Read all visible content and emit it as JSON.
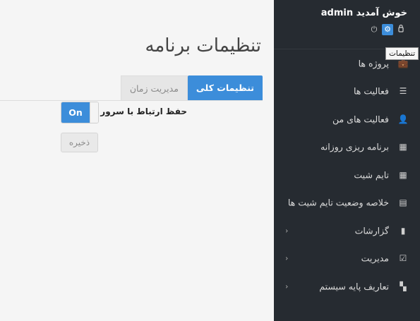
{
  "main": {
    "page_title": "تنظیمات برنامه",
    "tabs": [
      {
        "label": "تنظیمات کلی",
        "active": true
      },
      {
        "label": "مدیریت زمان",
        "active": false
      }
    ],
    "setting": {
      "label": "حفظ ارتباط با سرور",
      "toggle_on_text": "On",
      "value": true
    },
    "save_label": "ذخیره"
  },
  "sidebar": {
    "welcome": "admin خوش آمدید",
    "header_icons": [
      "power-icon",
      "gear-icon",
      "user-icon"
    ],
    "tooltip": "تنظیمات",
    "items": [
      {
        "label": "پروژه ها",
        "icon": "briefcase-icon",
        "glyph": "💼",
        "has_arrow": false
      },
      {
        "label": "فعالیت ها",
        "icon": "tasks-icon",
        "glyph": "☰",
        "has_arrow": false
      },
      {
        "label": "فعالیت های من",
        "icon": "user-tie-icon",
        "glyph": "👤",
        "has_arrow": false
      },
      {
        "label": "برنامه ریزی روزانه",
        "icon": "table-icon",
        "glyph": "▦",
        "has_arrow": false
      },
      {
        "label": "تایم شیت",
        "icon": "calendar-icon",
        "glyph": "▦",
        "has_arrow": false
      },
      {
        "label": "خلاصه وضعیت تایم شیت ها",
        "icon": "list-alt-icon",
        "glyph": "▤",
        "has_arrow": false
      },
      {
        "label": "گزارشات",
        "icon": "file-icon",
        "glyph": "▮",
        "has_arrow": true
      },
      {
        "label": "مدیریت",
        "icon": "check-square-icon",
        "glyph": "☑",
        "has_arrow": true
      },
      {
        "label": "تعاریف پایه سیستم",
        "icon": "th-large-icon",
        "glyph": "▚",
        "has_arrow": true
      }
    ]
  },
  "colors": {
    "accent": "#3c8dda",
    "sidebar_bg": "#262b31",
    "content_bg": "#f5f5f5"
  }
}
